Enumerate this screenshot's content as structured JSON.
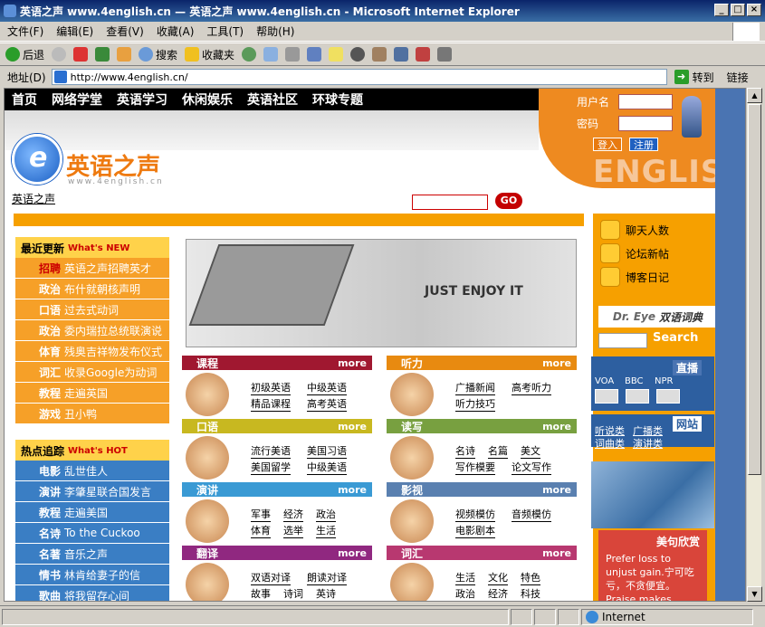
{
  "window": {
    "title": "英语之声 www.4english.cn — 英语之声 www.4english.cn - Microsoft Internet Explorer"
  },
  "menu": [
    "文件(F)",
    "编辑(E)",
    "查看(V)",
    "收藏(A)",
    "工具(T)",
    "帮助(H)"
  ],
  "toolbar": {
    "back": "后退",
    "search": "搜索",
    "favorites": "收藏夹"
  },
  "address": {
    "label": "地址(D)",
    "url": "http://www.4english.cn/",
    "go": "转到",
    "links": "链接"
  },
  "status": {
    "zone": "Internet"
  },
  "site": {
    "nav": [
      "首页",
      "网络学堂",
      "英语学习",
      "休闲娱乐",
      "英语社区",
      "环球专题"
    ],
    "brand": "英语之声",
    "domain": "www.4english.cn",
    "breadcrumb": "英语之声",
    "search_button": "GO",
    "login": {
      "username_label": "用户名",
      "password_label": "密码",
      "login_button": "登入",
      "register_button": "注册",
      "bg_text": "ENGLIS"
    },
    "recent": {
      "title": "最近更新",
      "title_en": "What's NEW",
      "items": [
        {
          "tag": "招聘",
          "text": "英语之声招聘英才"
        },
        {
          "tag": "政治",
          "text": "布什就朝核声明"
        },
        {
          "tag": "口语",
          "text": "过去式动词"
        },
        {
          "tag": "政治",
          "text": "委内瑞拉总统联演说"
        },
        {
          "tag": "体育",
          "text": "残奥吉祥物发布仪式"
        },
        {
          "tag": "词汇",
          "text": "收录Google为动词"
        },
        {
          "tag": "教程",
          "text": "走遍英国"
        },
        {
          "tag": "游戏",
          "text": "丑小鸭"
        }
      ]
    },
    "hot": {
      "title": "热点追踪",
      "title_en": "What's HOT",
      "items": [
        {
          "tag": "电影",
          "text": "乱世佳人"
        },
        {
          "tag": "演讲",
          "text": "李肇星联合国发言"
        },
        {
          "tag": "教程",
          "text": "走遍美国"
        },
        {
          "tag": "名诗",
          "text": "To the Cuckoo"
        },
        {
          "tag": "名著",
          "text": "音乐之声"
        },
        {
          "tag": "情书",
          "text": "林肯给妻子的信"
        },
        {
          "tag": "歌曲",
          "text": "将我留存心间"
        }
      ]
    },
    "banner_text": "JUST ENJOY IT",
    "more": "more",
    "categories": [
      {
        "title": "课程",
        "color": "#a01830",
        "links": [
          "初级英语",
          "中级英语",
          "精品课程",
          "高考英语"
        ]
      },
      {
        "title": "听力",
        "color": "#e88a10",
        "links": [
          "广播新闻",
          "高考听力",
          "听力技巧"
        ]
      },
      {
        "title": "口语",
        "color": "#c8b820",
        "links": [
          "流行美语",
          "美国习语",
          "美国留学",
          "中级美语"
        ]
      },
      {
        "title": "读写",
        "color": "#78a040",
        "links": [
          "名诗",
          "名篇",
          "美文",
          "写作模要",
          "论文写作"
        ]
      },
      {
        "title": "演讲",
        "color": "#3a9ad4",
        "links": [
          "军事",
          "经济",
          "政治",
          "体育",
          "选举",
          "生活"
        ]
      },
      {
        "title": "影视",
        "color": "#5a80b0",
        "links": [
          "视频模仿",
          "音频模仿",
          "电影剧本"
        ]
      },
      {
        "title": "翻译",
        "color": "#902880",
        "links": [
          "双语对译",
          "朗读对译",
          "故事",
          "诗词",
          "英诗"
        ]
      },
      {
        "title": "词汇",
        "color": "#b83870",
        "links": [
          "生活",
          "文化",
          "特色",
          "政治",
          "经济",
          "科技"
        ]
      }
    ],
    "right": {
      "chat": "聊天人数",
      "forum": "论坛新帖",
      "blog": "博客日记",
      "dict_brand": "Dr. Eye",
      "dict": "双语词典",
      "dict_search": "Search",
      "live": "直播",
      "radios": [
        "VOA",
        "BBC",
        "NPR"
      ],
      "web": "网站",
      "web_links": [
        "听说类",
        "广播类",
        "词曲类",
        "演讲类"
      ],
      "quote_title": "美句欣赏",
      "quote": "Prefer loss to unjust gain.宁可吃亏，不贪便宜。Praise makes"
    }
  }
}
